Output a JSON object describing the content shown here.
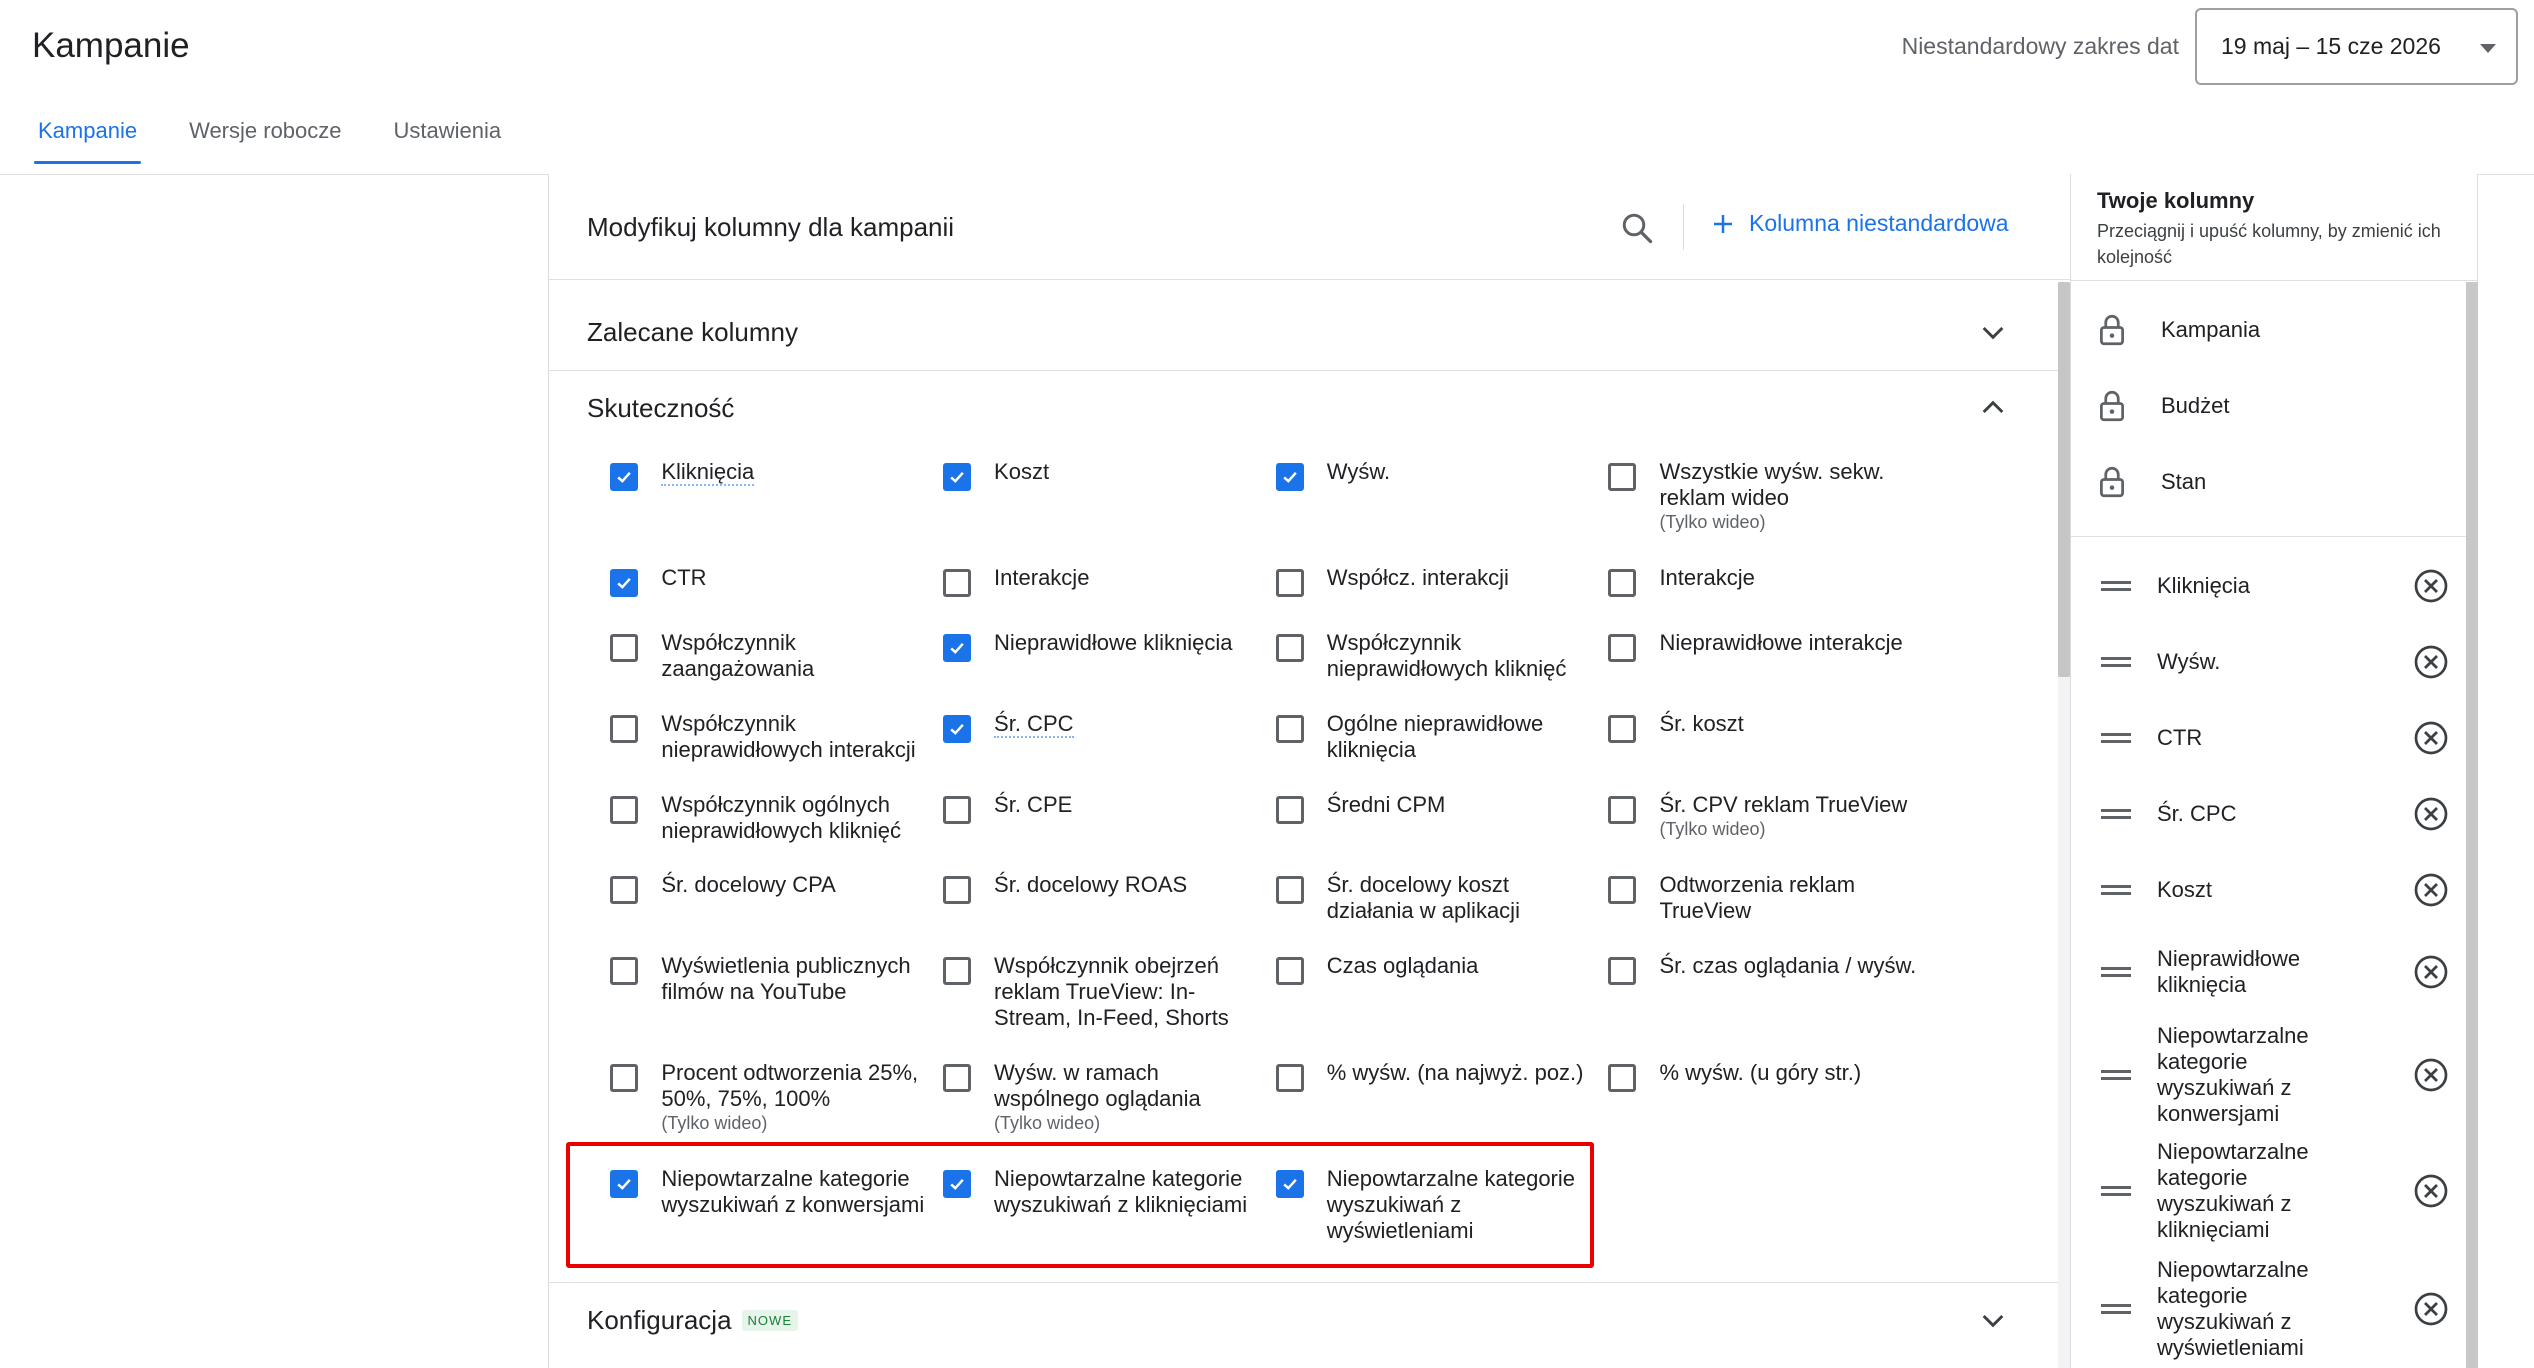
{
  "header": {
    "title": "Kampanie",
    "date_range_label": "Niestandardowy zakres dat",
    "date_range_value": "19 maj – 15 cze 2026"
  },
  "tabs": [
    {
      "label": "Kampanie",
      "active": true
    },
    {
      "label": "Wersje robocze",
      "active": false
    },
    {
      "label": "Ustawienia",
      "active": false
    }
  ],
  "panel": {
    "title": "Modyfikuj kolumny dla kampanii",
    "custom_column_label": "Kolumna niestandardowa",
    "sections": {
      "recommended": "Zalecane kolumny",
      "performance": "Skuteczność",
      "configuration": "Konfiguracja",
      "configuration_badge": "NOWE"
    }
  },
  "performance_items": [
    {
      "label": "Kliknięcia",
      "checked": true,
      "dotted": true,
      "sub": ""
    },
    {
      "label": "Koszt",
      "checked": true,
      "dotted": false,
      "sub": ""
    },
    {
      "label": "Wyśw.",
      "checked": true,
      "dotted": false,
      "sub": ""
    },
    {
      "label": "Wszystkie wyśw. sekw. reklam wideo",
      "checked": false,
      "dotted": false,
      "sub": "(Tylko wideo)"
    },
    {
      "label": "CTR",
      "checked": true,
      "dotted": false,
      "sub": ""
    },
    {
      "label": "Interakcje",
      "checked": false,
      "dotted": false,
      "sub": ""
    },
    {
      "label": "Współcz. interakcji",
      "checked": false,
      "dotted": false,
      "sub": ""
    },
    {
      "label": "Interakcje",
      "checked": false,
      "dotted": false,
      "sub": ""
    },
    {
      "label": "Współczynnik zaangażowania",
      "checked": false,
      "dotted": false,
      "sub": ""
    },
    {
      "label": "Nieprawidłowe kliknięcia",
      "checked": true,
      "dotted": false,
      "sub": ""
    },
    {
      "label": "Współczynnik nieprawidłowych kliknięć",
      "checked": false,
      "dotted": false,
      "sub": ""
    },
    {
      "label": "Nieprawidłowe interakcje",
      "checked": false,
      "dotted": false,
      "sub": ""
    },
    {
      "label": "Współczynnik nieprawidłowych interakcji",
      "checked": false,
      "dotted": false,
      "sub": ""
    },
    {
      "label": "Śr. CPC",
      "checked": true,
      "dotted": true,
      "sub": ""
    },
    {
      "label": "Ogólne nieprawidłowe kliknięcia",
      "checked": false,
      "dotted": false,
      "sub": ""
    },
    {
      "label": "Śr. koszt",
      "checked": false,
      "dotted": false,
      "sub": ""
    },
    {
      "label": "Współczynnik ogólnych nieprawidłowych kliknięć",
      "checked": false,
      "dotted": false,
      "sub": ""
    },
    {
      "label": "Śr. CPE",
      "checked": false,
      "dotted": false,
      "sub": ""
    },
    {
      "label": "Średni CPM",
      "checked": false,
      "dotted": false,
      "sub": ""
    },
    {
      "label": "Śr. CPV reklam TrueView",
      "checked": false,
      "dotted": false,
      "sub": "(Tylko wideo)"
    },
    {
      "label": "Śr. docelowy CPA",
      "checked": false,
      "dotted": false,
      "sub": ""
    },
    {
      "label": "Śr. docelowy ROAS",
      "checked": false,
      "dotted": false,
      "sub": ""
    },
    {
      "label": "Śr. docelowy koszt działania w aplikacji",
      "checked": false,
      "dotted": false,
      "sub": ""
    },
    {
      "label": "Odtworzenia reklam TrueView",
      "checked": false,
      "dotted": false,
      "sub": ""
    },
    {
      "label": "Wyświetlenia publicznych filmów na YouTube",
      "checked": false,
      "dotted": false,
      "sub": ""
    },
    {
      "label": "Współczynnik obejrzeń reklam TrueView: In-Stream, In-Feed, Shorts",
      "checked": false,
      "dotted": false,
      "sub": ""
    },
    {
      "label": "Czas oglądania",
      "checked": false,
      "dotted": false,
      "sub": ""
    },
    {
      "label": "Śr. czas oglądania / wyśw.",
      "checked": false,
      "dotted": false,
      "sub": ""
    },
    {
      "label": "Procent odtworzenia 25%, 50%, 75%, 100%",
      "checked": false,
      "dotted": false,
      "sub": "(Tylko wideo)"
    },
    {
      "label": "Wyśw. w ramach wspólnego oglądania",
      "checked": false,
      "dotted": false,
      "sub": "(Tylko wideo)"
    },
    {
      "label": "% wyśw. (na najwyż. poz.)",
      "checked": false,
      "dotted": false,
      "sub": ""
    },
    {
      "label": "% wyśw. (u góry str.)",
      "checked": false,
      "dotted": false,
      "sub": ""
    },
    {
      "label": "Niepowtarzalne kategorie wyszukiwań z konwersjami",
      "checked": true,
      "dotted": false,
      "sub": ""
    },
    {
      "label": "Niepowtarzalne kategorie wyszukiwań z kliknięciami",
      "checked": true,
      "dotted": false,
      "sub": ""
    },
    {
      "label": "Niepowtarzalne kategorie wyszukiwań z wyświetleniami",
      "checked": true,
      "dotted": false,
      "sub": ""
    }
  ],
  "right_panel": {
    "title": "Twoje kolumny",
    "subtitle": "Przeciągnij i upuść kolumny, by zmienić ich kolejność",
    "locked": [
      "Kampania",
      "Budżet",
      "Stan"
    ],
    "columns": [
      "Kliknięcia",
      "Wyśw.",
      "CTR",
      "Śr. CPC",
      "Koszt",
      "Nieprawidłowe kliknięcia",
      "Niepowtarzalne kategorie wyszukiwań z konwersjami",
      "Niepowtarzalne kategorie wyszukiwań z kliknięciami",
      "Niepowtarzalne kategorie wyszukiwań z wyświetleniami"
    ]
  },
  "colors": {
    "accent": "#1a73e8",
    "highlight": "#ea0000",
    "new_badge": "#188038"
  }
}
